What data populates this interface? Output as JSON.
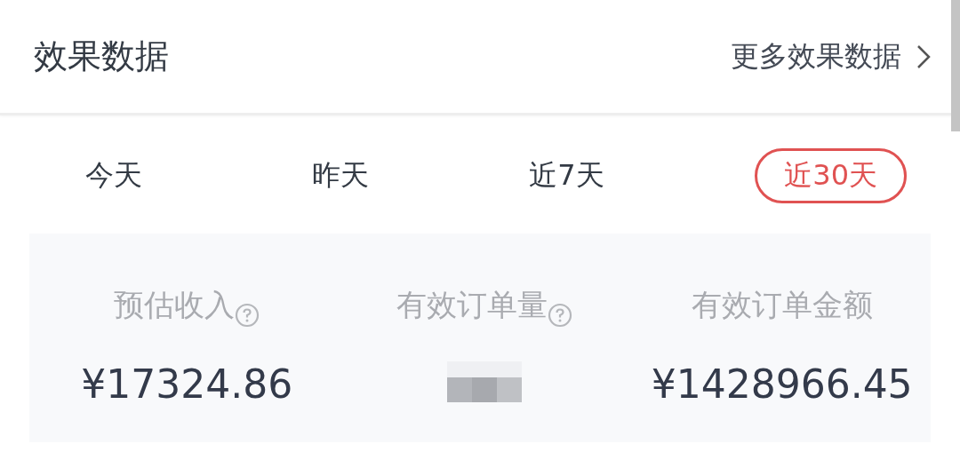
{
  "header": {
    "title": "效果数据",
    "link": "更多效果数据"
  },
  "tabs": [
    {
      "label": "今天",
      "selected": false
    },
    {
      "label": "昨天",
      "selected": false
    },
    {
      "label": "近7天",
      "selected": false
    },
    {
      "label": "近30天",
      "selected": true
    }
  ],
  "metrics": [
    {
      "label": "预估收入",
      "help": true,
      "hidden": false,
      "value": "¥17324.86"
    },
    {
      "label": "有效订单量",
      "help": true,
      "hidden": true
    },
    {
      "label": "有效订单金额",
      "help": false,
      "hidden": false,
      "value": "¥1428966.45"
    }
  ]
}
